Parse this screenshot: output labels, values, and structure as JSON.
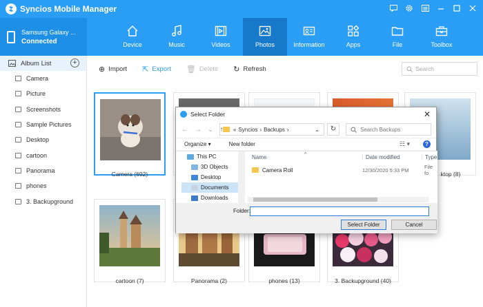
{
  "app": {
    "title": "Syncios Mobile Manager"
  },
  "device": {
    "name": "Samsung Galaxy ...",
    "status": "Connected"
  },
  "nav": {
    "tabs": [
      {
        "label": "Device",
        "icon": "home-icon"
      },
      {
        "label": "Music",
        "icon": "music-note-icon"
      },
      {
        "label": "Videos",
        "icon": "film-icon"
      },
      {
        "label": "Photos",
        "icon": "image-icon",
        "active": true
      },
      {
        "label": "Information",
        "icon": "contact-card-icon"
      },
      {
        "label": "Apps",
        "icon": "apps-grid-icon"
      },
      {
        "label": "File",
        "icon": "folder-icon"
      },
      {
        "label": "Toolbox",
        "icon": "toolbox-icon"
      }
    ]
  },
  "sidebar": {
    "header": "Album List",
    "items": [
      "Camera",
      "Picture",
      "Screenshots",
      "Sample Pictures",
      "Desktop",
      "cartoon",
      "Panorama",
      "phones",
      "3. Backupground"
    ]
  },
  "toolbar": {
    "import": "Import",
    "export": "Export",
    "delete": "Delete",
    "refresh": "Refresh",
    "search_placeholder": "Search"
  },
  "albums": [
    {
      "caption": "Camera (692)"
    },
    {
      "caption": ""
    },
    {
      "caption": ""
    },
    {
      "caption": ""
    },
    {
      "caption": "ktop (8)"
    },
    {
      "caption": "cartoon (7)"
    },
    {
      "caption": "Panorama (2)"
    },
    {
      "caption": "phones (13)"
    },
    {
      "caption": "3. Backupground (40)"
    }
  ],
  "dialog": {
    "title": "Select Folder",
    "path": [
      "«",
      "Syncios",
      "›",
      "Backups",
      "›"
    ],
    "search_placeholder": "Search Backups",
    "organize": "Organize ▾",
    "new_folder": "New folder",
    "tree": [
      "This PC",
      "3D Objects",
      "Desktop",
      "Documents",
      "Downloads"
    ],
    "columns": {
      "name": "Name",
      "date": "Date modified",
      "type": "Type"
    },
    "files": [
      {
        "name": "Camera Roll",
        "date": "12/30/2020 5:33 PM",
        "type": "File fo"
      }
    ],
    "folder_label": "Folder:",
    "folder_value": "",
    "select_btn": "Select Folder",
    "cancel_btn": "Cancel"
  },
  "colors": {
    "accent": "#2a9df4",
    "accent_dark": "#1779c9"
  }
}
